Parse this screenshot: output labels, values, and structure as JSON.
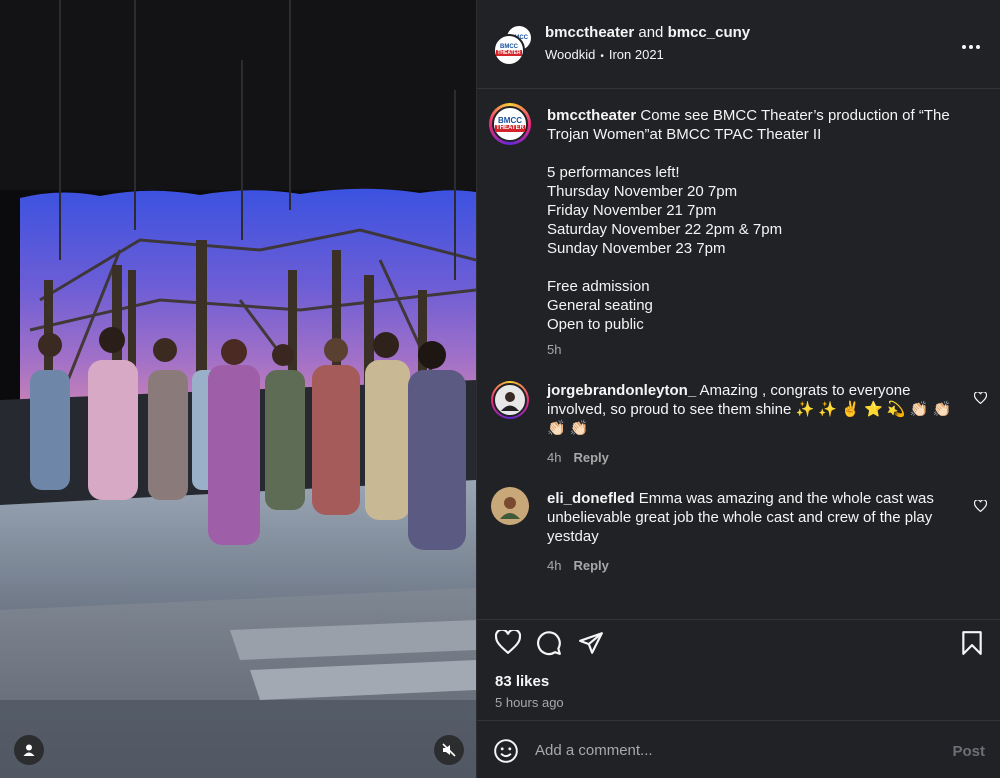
{
  "header": {
    "user1": "bmcctheater",
    "and_text": "and",
    "user2": "bmcc_cuny",
    "artist": "Woodkid",
    "song": "Iron 2021",
    "bmcc_logo_text": "BMCC",
    "theater_logo_text": "THEATER"
  },
  "caption": {
    "username": "bmcctheater",
    "lines": [
      "Come see BMCC Theater’s production of “The Trojan Women”at BMCC TPAC Theater II",
      "",
      "5 performances left!",
      "Thursday November 20 7pm",
      "Friday November 21 7pm",
      "Saturday November 22 2pm & 7pm",
      "Sunday November 23 7pm",
      "",
      "Free admission",
      "General seating",
      "Open to public"
    ],
    "time": "5h"
  },
  "comments": [
    {
      "username": "jorgebrandonleyton_",
      "text": "Amazing , congrats to everyone involved, so proud to see them shine ✨ ✨ ✌️ ⭐ 💫 👏🏻 👏🏻 👏🏻 👏🏻",
      "time": "4h",
      "reply": "Reply"
    },
    {
      "username": "eli_donefled",
      "text": "Emma was amazing and the whole cast was unbelievable great job the whole cast and crew of the play yestday",
      "time": "4h",
      "reply": "Reply"
    }
  ],
  "stats": {
    "likes": "83 likes",
    "posted": "5 hours ago"
  },
  "add_comment": {
    "placeholder": "Add a comment...",
    "post_label": "Post"
  },
  "icons": {
    "more": "more-icon",
    "heart": "heart-icon",
    "comment": "comment-icon",
    "share": "share-icon",
    "save": "bookmark-icon",
    "emoji": "emoji-icon",
    "user": "user-icon",
    "mute": "mute-icon"
  },
  "colors": {
    "panel_bg": "#212226",
    "text": "#f5f5f5",
    "muted": "#a8a8a8",
    "post_disabled": "#6d6f76"
  }
}
